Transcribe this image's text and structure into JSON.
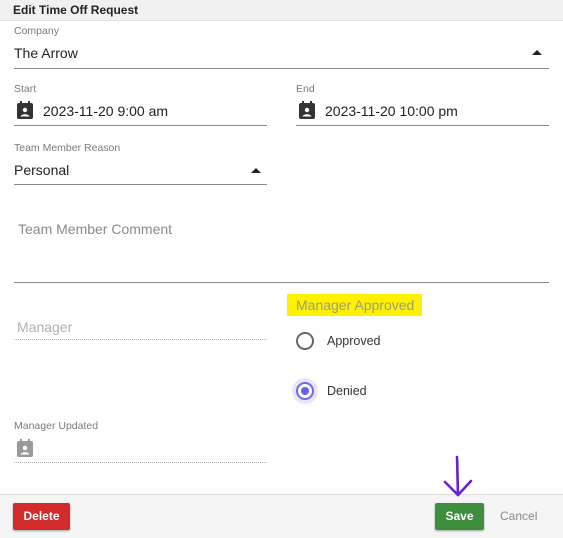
{
  "dialog": {
    "title": "Edit Time Off Request"
  },
  "form": {
    "company": {
      "label": "Company",
      "value": "The Arrow"
    },
    "start": {
      "label": "Start",
      "value": "2023-11-20 9:00 am"
    },
    "end": {
      "label": "End",
      "value": "2023-11-20 10:00 pm"
    },
    "reason": {
      "label": "Team Member Reason",
      "value": "Personal"
    },
    "comment": {
      "placeholder": "Team Member Comment"
    },
    "manager": {
      "placeholder": "Manager"
    },
    "manager_approved": {
      "label": "Manager Approved",
      "options": [
        {
          "label": "Approved",
          "selected": false
        },
        {
          "label": "Denied",
          "selected": true
        }
      ],
      "highlight_color": "#fff200",
      "selected_color": "#6a5ee8"
    },
    "manager_updated": {
      "label": "Manager Updated",
      "value": ""
    }
  },
  "footer": {
    "delete_label": "Delete",
    "save_label": "Save",
    "cancel_label": "Cancel"
  },
  "colors": {
    "delete": "#d32b2b",
    "save": "#3d8f3d",
    "annotation_arrow": "#6a1fd0"
  },
  "icons": {
    "calendar": "calendar-icon",
    "caret": "caret-up-icon",
    "arrow": "arrow-down-annotation"
  }
}
